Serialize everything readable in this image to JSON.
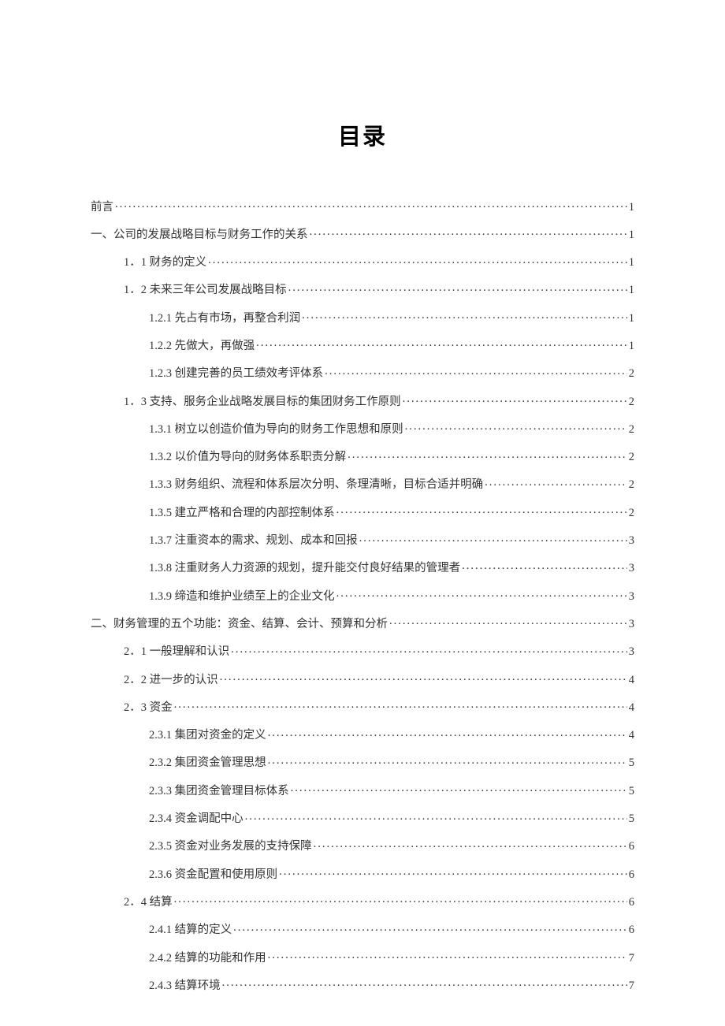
{
  "title": "目录",
  "entries": [
    {
      "level": 0,
      "label": "前言",
      "page": "1"
    },
    {
      "level": 0,
      "label": "一、公司的发展战略目标与财务工作的关系",
      "page": "1"
    },
    {
      "level": 1,
      "label": "1．1 财务的定义",
      "page": "1"
    },
    {
      "level": 1,
      "label": "1．2 未来三年公司发展战略目标",
      "page": "1"
    },
    {
      "level": 2,
      "label": "1.2.1 先占有市场，再整合利润",
      "page": "1"
    },
    {
      "level": 2,
      "label": "1.2.2 先做大，再做强",
      "page": "1"
    },
    {
      "level": 2,
      "label": "1.2.3 创建完善的员工绩效考评体系",
      "page": "2"
    },
    {
      "level": 1,
      "label": "1．3 支持、服务企业战略发展目标的集团财务工作原则",
      "page": "2"
    },
    {
      "level": 2,
      "label": "1.3.1 树立以创造价值为导向的财务工作思想和原则",
      "page": "2"
    },
    {
      "level": 2,
      "label": "1.3.2 以价值为导向的财务体系职责分解",
      "page": "2"
    },
    {
      "level": 2,
      "label": "1.3.3 财务组织、流程和体系层次分明、条理清晰，目标合适并明确",
      "page": "2"
    },
    {
      "level": 2,
      "label": "1.3.5 建立严格和合理的内部控制体系",
      "page": "2"
    },
    {
      "level": 2,
      "label": "1.3.7 注重资本的需求、规划、成本和回报",
      "page": "3"
    },
    {
      "level": 2,
      "label": "1.3.8 注重财务人力资源的规划，提升能交付良好结果的管理者",
      "page": "3"
    },
    {
      "level": 2,
      "label": "1.3.9 缔造和维护业绩至上的企业文化",
      "page": "3"
    },
    {
      "level": 0,
      "label": "二、财务管理的五个功能：资金、结算、会计、预算和分析",
      "page": "3"
    },
    {
      "level": 1,
      "label": "2．1 一般理解和认识",
      "page": "3"
    },
    {
      "level": 1,
      "label": "2．2 进一步的认识",
      "page": "4"
    },
    {
      "level": 1,
      "label": "2．3 资金",
      "page": "4"
    },
    {
      "level": 2,
      "label": "2.3.1 集团对资金的定义",
      "page": "4"
    },
    {
      "level": 2,
      "label": "2.3.2 集团资金管理思想",
      "page": "5"
    },
    {
      "level": 2,
      "label": "2.3.3 集团资金管理目标体系",
      "page": "5"
    },
    {
      "level": 2,
      "label": "2.3.4 资金调配中心",
      "page": "5"
    },
    {
      "level": 2,
      "label": "2.3.5 资金对业务发展的支持保障",
      "page": "6"
    },
    {
      "level": 2,
      "label": "2.3.6 资金配置和使用原则",
      "page": "6"
    },
    {
      "level": 1,
      "label": "2．4 结算",
      "page": "6"
    },
    {
      "level": 2,
      "label": "2.4.1 结算的定义",
      "page": "6"
    },
    {
      "level": 2,
      "label": "2.4.2 结算的功能和作用",
      "page": "7"
    },
    {
      "level": 2,
      "label": "2.4.3 结算环境",
      "page": "7"
    }
  ]
}
